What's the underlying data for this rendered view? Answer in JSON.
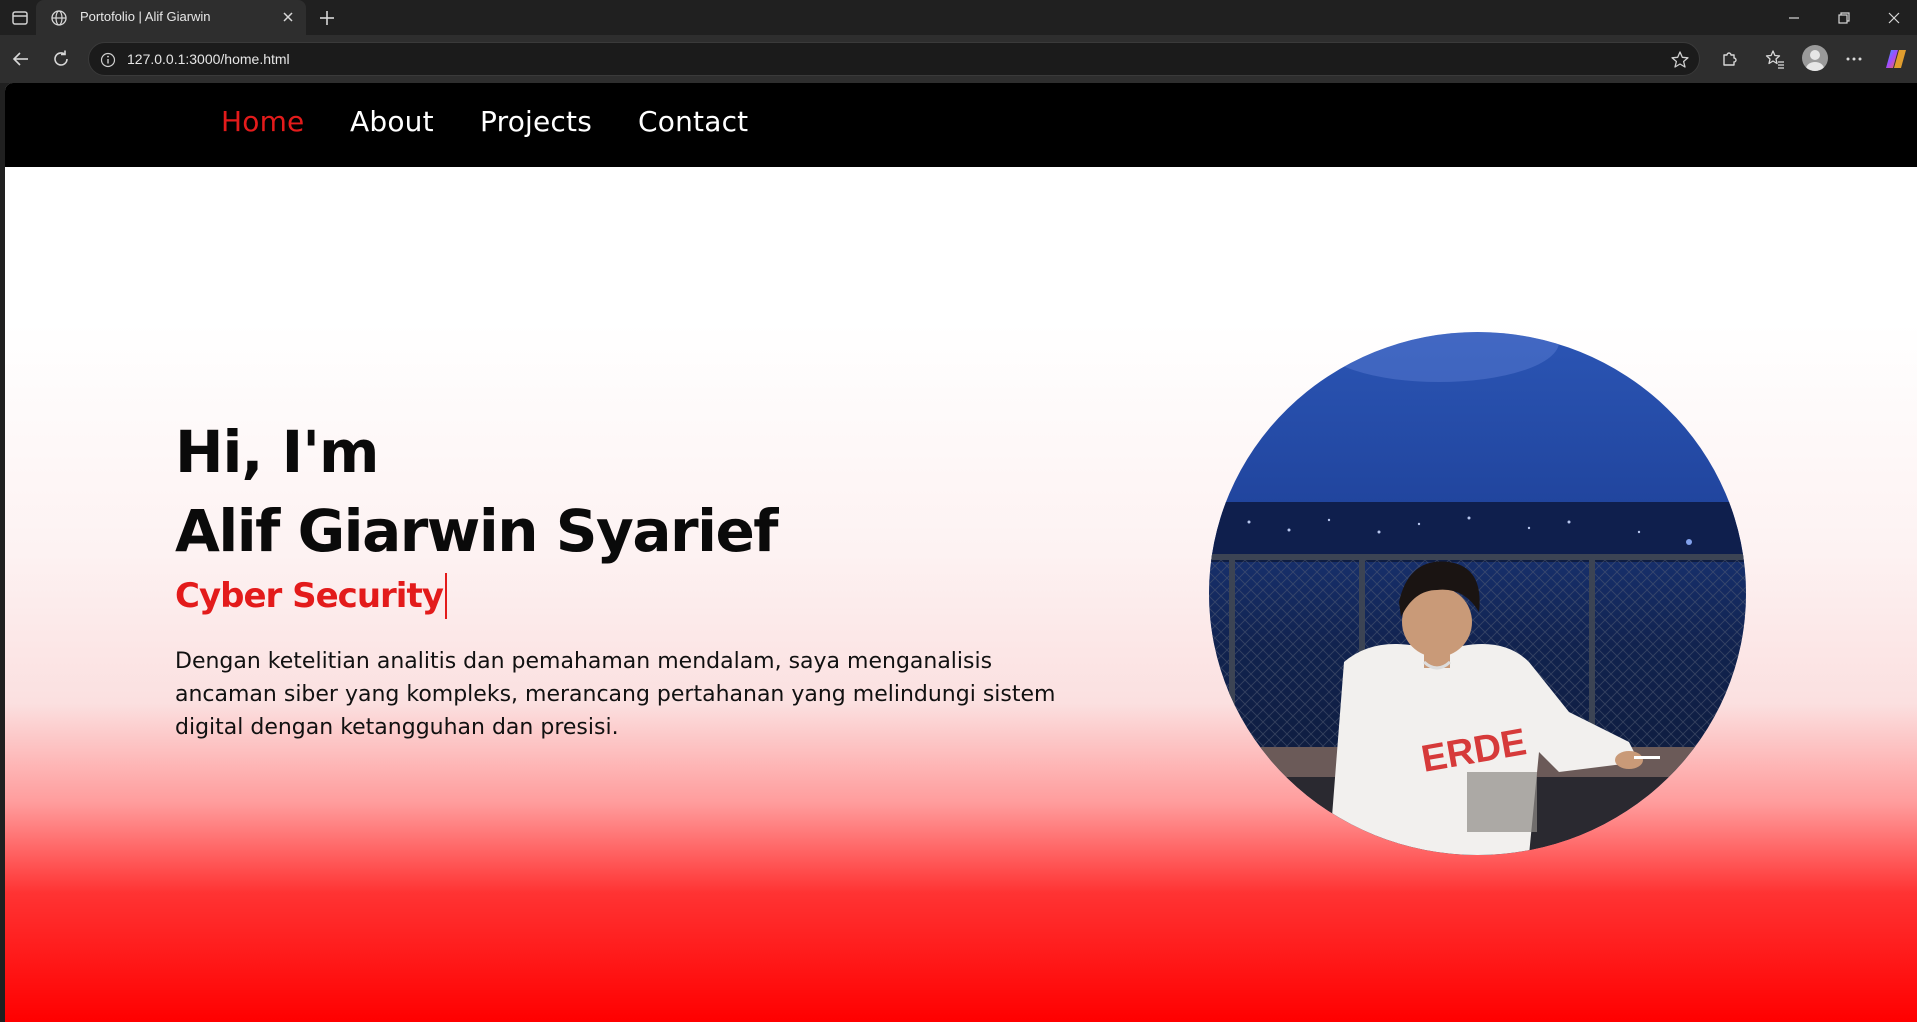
{
  "browser": {
    "tab_title": "Portofolio | Alif Giarwin",
    "url": "127.0.0.1:3000/home.html"
  },
  "nav": {
    "items": [
      {
        "label": "Home",
        "active": true
      },
      {
        "label": "About",
        "active": false
      },
      {
        "label": "Projects",
        "active": false
      },
      {
        "label": "Contact",
        "active": false
      }
    ]
  },
  "hero": {
    "greeting": "Hi, I'm",
    "name": "Alif Giarwin Syarief",
    "role": "Cyber Security",
    "description": "Dengan ketelitian analitis dan pemahaman mendalam, saya menganalisis ancaman siber yang kompleks, merancang pertahanan yang melindungi sistem digital dengan ketangguhan dan presisi."
  },
  "colors": {
    "accent": "#e31b1b",
    "navbar_bg": "#000000",
    "gradient_bottom": "#ff0000"
  }
}
